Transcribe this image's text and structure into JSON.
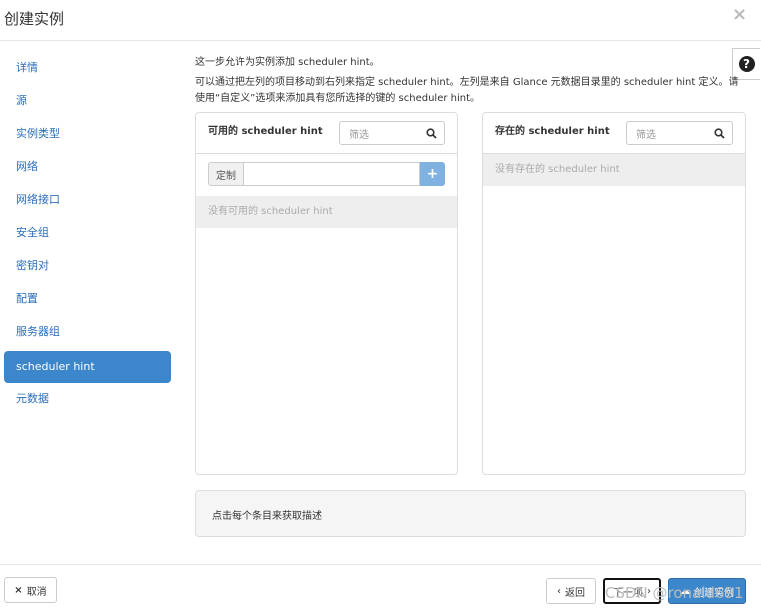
{
  "modal": {
    "title": "创建实例",
    "close_icon": "×",
    "help_icon": "?"
  },
  "nav": {
    "items": [
      {
        "label": "详情"
      },
      {
        "label": "源"
      },
      {
        "label": "实例类型"
      },
      {
        "label": "网络"
      },
      {
        "label": "网络接口"
      },
      {
        "label": "安全组"
      },
      {
        "label": "密钥对"
      },
      {
        "label": "配置"
      },
      {
        "label": "服务器组"
      },
      {
        "label": "scheduler hint"
      },
      {
        "label": "元数据"
      }
    ],
    "active_index": 9
  },
  "content": {
    "desc1": "这一步允许为实例添加 scheduler hint。",
    "desc2": "可以通过把左列的项目移动到右列来指定 scheduler hint。左列是来自 Glance 元数据目录里的 scheduler hint 定义。请使用“自定义”选项来添加具有您所选择的键的 scheduler hint。",
    "available": {
      "title": "可用的 scheduler hint",
      "filter_placeholder": "筛选",
      "custom_label": "定制",
      "add_icon": "+",
      "empty": "没有可用的 scheduler hint"
    },
    "existing": {
      "title": "存在的 scheduler hint",
      "filter_placeholder": "筛选",
      "empty": "没有存在的 scheduler hint"
    },
    "item_desc": "点击每个条目来获取描述"
  },
  "footer": {
    "cancel": "取消",
    "back": "返回",
    "next": "下一项",
    "create": "创建实例"
  },
  "watermark": "CSDN @ronald691",
  "colors": {
    "primary": "#3c86cc",
    "link": "#2a6ebb",
    "add_button": "#7fb2e0"
  }
}
